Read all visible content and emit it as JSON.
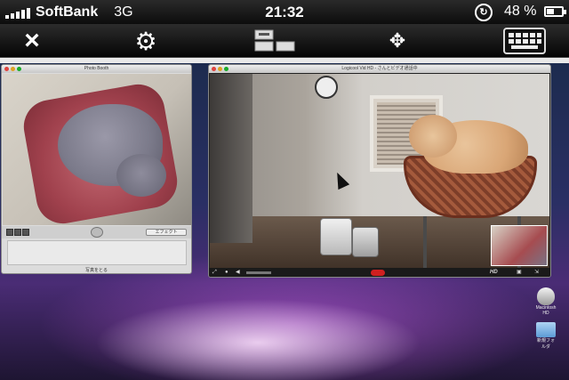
{
  "status_bar": {
    "carrier": "SoftBank",
    "network": "3G",
    "time": "21:32",
    "battery_percent": "48 %",
    "battery_level": 0.48,
    "signal_bars": 5
  },
  "toolbar": {
    "close_icon": "×",
    "settings_icon": "⚙",
    "monitors_icon": "monitor-select-icon",
    "move_icon": "✥",
    "keyboard_icon": "keyboard-icon"
  },
  "remote_desktop": {
    "photo_booth": {
      "title": "Photo Booth",
      "app_menu": "Logicool Vid HD",
      "effects_button": "エフェクト",
      "footer": "写真をとる"
    },
    "vid_window": {
      "title": "Logicool Vid HD - さんとビデオ通話中",
      "hd_badge": "HD"
    },
    "desktop_icons": {
      "disk_label": "Macintosh HD",
      "folder_label": "新規フォルダ"
    }
  }
}
